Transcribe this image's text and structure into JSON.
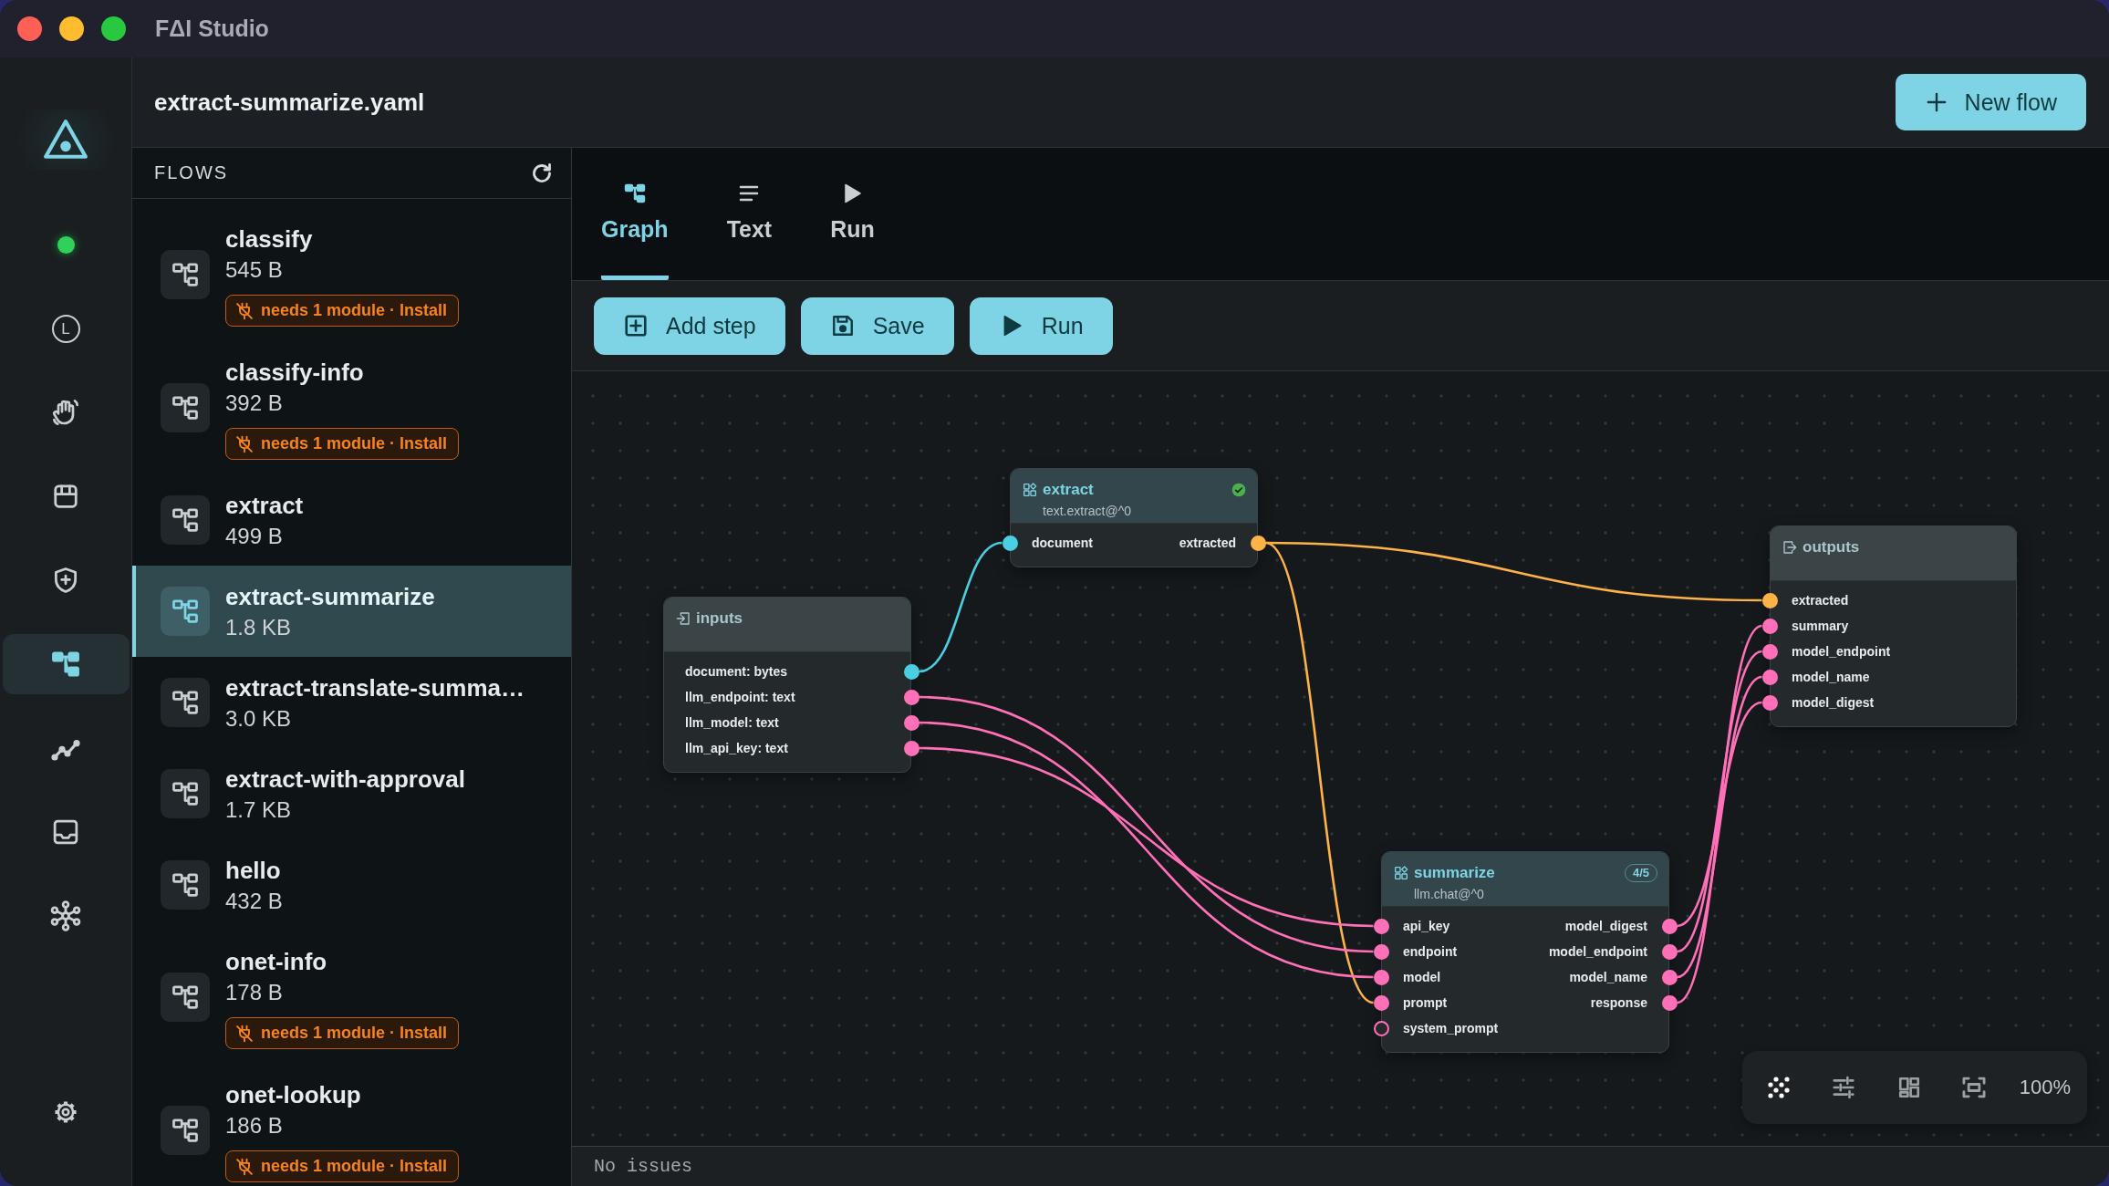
{
  "window": {
    "title": "FΔI Studio"
  },
  "nav": {
    "online": true,
    "items": [
      {
        "kind": "letter",
        "label": "L",
        "selected": false
      },
      {
        "kind": "hand",
        "selected": false
      },
      {
        "kind": "store",
        "selected": false
      },
      {
        "kind": "shield",
        "selected": false
      },
      {
        "kind": "flows",
        "selected": true
      },
      {
        "kind": "chart",
        "selected": false
      },
      {
        "kind": "inbox",
        "selected": false
      },
      {
        "kind": "network",
        "selected": false
      },
      {
        "kind": "settings",
        "selected": false
      }
    ]
  },
  "header": {
    "file": "extract-summarize.yaml",
    "new_button": "New flow"
  },
  "flows_panel": {
    "title": "FLOWS",
    "items": [
      {
        "name": "classify",
        "size": "545 B",
        "selected": false,
        "warning": "needs 1 module · Install"
      },
      {
        "name": "classify-info",
        "size": "392 B",
        "selected": false,
        "warning": "needs 1 module · Install"
      },
      {
        "name": "extract",
        "size": "499 B",
        "selected": false
      },
      {
        "name": "extract-summarize",
        "size": "1.8 KB",
        "selected": true
      },
      {
        "name": "extract-translate-summa…",
        "size": "3.0 KB",
        "selected": false
      },
      {
        "name": "extract-with-approval",
        "size": "1.7 KB",
        "selected": false
      },
      {
        "name": "hello",
        "size": "432 B",
        "selected": false
      },
      {
        "name": "onet-info",
        "size": "178 B",
        "selected": false,
        "warning": "needs 1 module · Install"
      },
      {
        "name": "onet-lookup",
        "size": "186 B",
        "selected": false,
        "warning": "needs 1 module · Install"
      }
    ]
  },
  "tabs": [
    {
      "kind": "graph",
      "label": "Graph",
      "selected": true
    },
    {
      "kind": "text",
      "label": "Text",
      "selected": false
    },
    {
      "kind": "run",
      "label": "Run",
      "selected": false
    }
  ],
  "toolbar": [
    {
      "kind": "add",
      "label": "Add step"
    },
    {
      "kind": "save",
      "label": "Save"
    },
    {
      "kind": "run",
      "label": "Run"
    }
  ],
  "graph": {
    "nodes": [
      {
        "kind": "input",
        "title": "inputs",
        "outputs": [
          {
            "label": "document: bytes",
            "color": "#4acfe2",
            "connected": true
          },
          {
            "label": "llm_endpoint: text",
            "color": "#ff70b8",
            "connected": true
          },
          {
            "label": "llm_model: text",
            "color": "#ff70b8",
            "connected": true
          },
          {
            "label": "llm_api_key: text",
            "color": "#ff70b8",
            "connected": true
          }
        ]
      },
      {
        "kind": "step",
        "title": "extract",
        "subtitle": "text.extract@^0",
        "complete": true,
        "inputs": [
          {
            "label": "document",
            "color": "#4acfe2",
            "connected": true
          }
        ],
        "outputs": [
          {
            "label": "extracted",
            "color": "#fdb347",
            "connected": true
          }
        ]
      },
      {
        "kind": "step",
        "title": "summarize",
        "subtitle": "llm.chat@^0",
        "badge": "4/5",
        "complete": false,
        "inputs": [
          {
            "label": "api_key",
            "color": "#ff70b8",
            "connected": true
          },
          {
            "label": "endpoint",
            "color": "#ff70b8",
            "connected": true
          },
          {
            "label": "model",
            "color": "#ff70b8",
            "connected": true
          },
          {
            "label": "prompt",
            "color": "#ff70b8",
            "connected": true
          },
          {
            "label": "system_prompt",
            "color": "#ff70b8",
            "connected": false
          }
        ],
        "outputs": [
          {
            "label": "model_digest",
            "color": "#ff70b8",
            "connected": true
          },
          {
            "label": "model_endpoint",
            "color": "#ff70b8",
            "connected": true
          },
          {
            "label": "model_name",
            "color": "#ff70b8",
            "connected": true
          },
          {
            "label": "response",
            "color": "#ff70b8",
            "connected": true
          }
        ]
      },
      {
        "kind": "output",
        "title": "outputs",
        "inputs": [
          {
            "label": "extracted",
            "color": "#fdb347",
            "connected": true
          },
          {
            "label": "summary",
            "color": "#ff70b8",
            "connected": true
          },
          {
            "label": "model_endpoint",
            "color": "#ff70b8",
            "connected": true
          },
          {
            "label": "model_name",
            "color": "#ff70b8",
            "connected": true
          },
          {
            "label": "model_digest",
            "color": "#ff70b8",
            "connected": true
          }
        ]
      }
    ]
  },
  "canvas_controls": {
    "items": [
      {
        "kind": "grid",
        "on": true
      },
      {
        "kind": "tune",
        "on": false
      },
      {
        "kind": "layout",
        "on": false
      },
      {
        "kind": "fit",
        "on": false
      }
    ],
    "zoom": "100%"
  },
  "status_bar": {
    "message": "No issues"
  }
}
